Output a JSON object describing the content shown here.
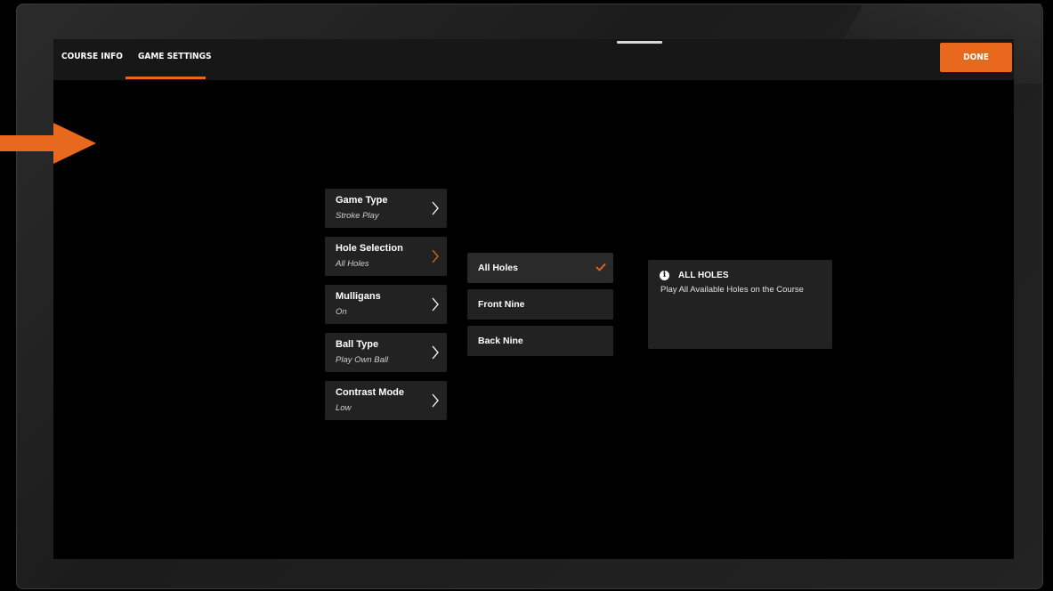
{
  "tabs": [
    {
      "label": "COURSE INFO"
    },
    {
      "label": "GAME SETTINGS",
      "active": true
    }
  ],
  "done_label": "DONE",
  "accent_color": "#e8681d",
  "settings": [
    {
      "label": "Game Type",
      "value": "Stroke Play"
    },
    {
      "label": "Hole Selection",
      "value": "All Holes",
      "active": true
    },
    {
      "label": "Mulligans",
      "value": "On"
    },
    {
      "label": "Ball Type",
      "value": "Play Own Ball"
    },
    {
      "label": "Contrast Mode",
      "value": "Low"
    }
  ],
  "hole_options": [
    {
      "label": "All Holes",
      "selected": true
    },
    {
      "label": "Front Nine"
    },
    {
      "label": "Back Nine"
    }
  ],
  "info": {
    "icon": "info-icon",
    "title": "ALL HOLES",
    "description": "Play All Available Holes on the Course"
  }
}
